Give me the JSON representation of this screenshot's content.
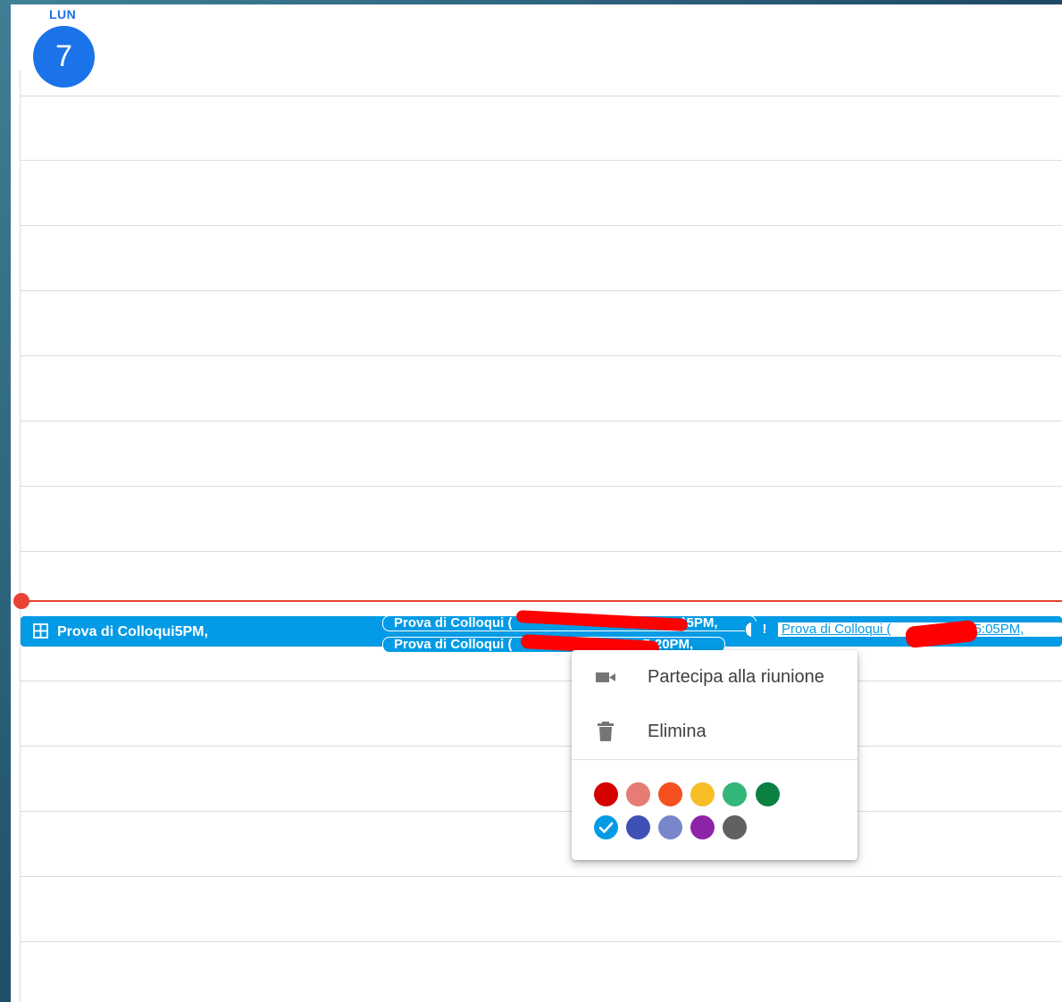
{
  "header": {
    "day_label": "LUN",
    "day_number": "7"
  },
  "events": {
    "main": {
      "title": "Prova di Colloqui",
      "time": "5PM,",
      "icon": "grid-plus-icon",
      "color": "#039be5"
    },
    "sub": [
      {
        "title": "Prova di Colloqui (",
        "time": ")5PM,"
      },
      {
        "title": "Prova di Colloqui (",
        "time": "5:20PM,"
      },
      {
        "title": "Prova di Colloqui (",
        "time": ")5:05PM,",
        "status_icon": "exclamation-icon",
        "declined": true
      }
    ]
  },
  "context_menu": {
    "items": [
      {
        "label": "Partecipa alla riunione",
        "icon": "videocam-icon"
      },
      {
        "label": "Elimina",
        "icon": "trash-icon"
      }
    ],
    "colors": [
      {
        "name": "tomato",
        "hex": "#d50000"
      },
      {
        "name": "flamingo",
        "hex": "#e67c73"
      },
      {
        "name": "tangerine",
        "hex": "#f4511e"
      },
      {
        "name": "banana",
        "hex": "#f6bf26"
      },
      {
        "name": "sage",
        "hex": "#33b679"
      },
      {
        "name": "basil",
        "hex": "#0b8043"
      },
      {
        "name": "peacock",
        "hex": "#039be5",
        "selected": true
      },
      {
        "name": "blueberry",
        "hex": "#3f51b5"
      },
      {
        "name": "lavender",
        "hex": "#7986cb"
      },
      {
        "name": "grape",
        "hex": "#8e24aa"
      },
      {
        "name": "graphite",
        "hex": "#616161"
      }
    ]
  },
  "colors": {
    "primary": "#1a73e8",
    "now_indicator": "#ea4335",
    "gridline": "#dadce0"
  }
}
